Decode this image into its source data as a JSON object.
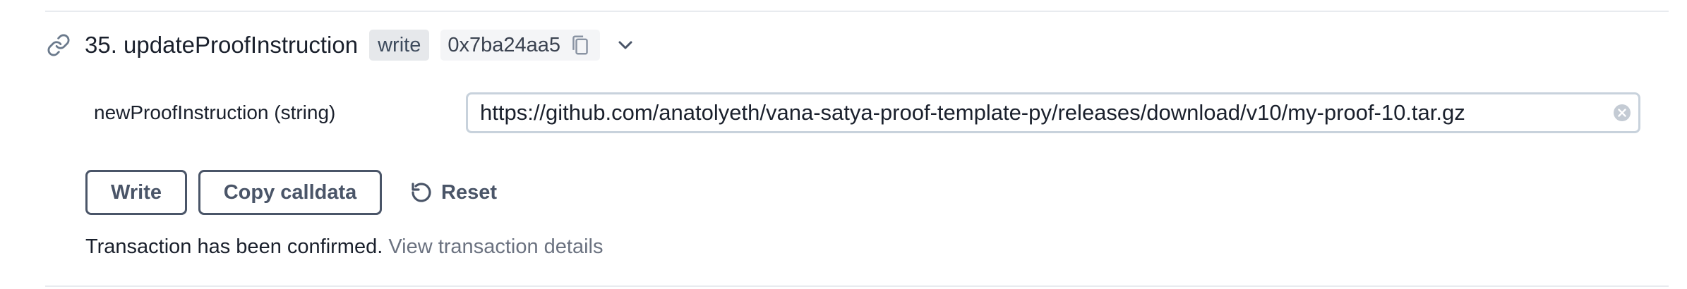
{
  "method": {
    "title": "35. updateProofInstruction",
    "tag": "write",
    "address": "0x7ba24aa5"
  },
  "param": {
    "label": "newProofInstruction (string)",
    "value": "https://github.com/anatolyeth/vana-satya-proof-template-py/releases/download/v10/my-proof-10.tar.gz"
  },
  "actions": {
    "write_label": "Write",
    "copy_label": "Copy calldata",
    "reset_label": "Reset"
  },
  "status": {
    "message": "Transaction has been confirmed.",
    "link_label": "View transaction details"
  },
  "icons": {
    "link": "link-icon",
    "copy": "copy-icon",
    "chevron": "chevron-down-icon",
    "clear": "clear-icon",
    "reset": "reset-icon"
  },
  "colors": {
    "text": "#1a202c",
    "muted": "#6b7280",
    "button_border": "#4a5568",
    "tag_bg": "#e6e8eb",
    "input_border": "#c8d2dc"
  }
}
